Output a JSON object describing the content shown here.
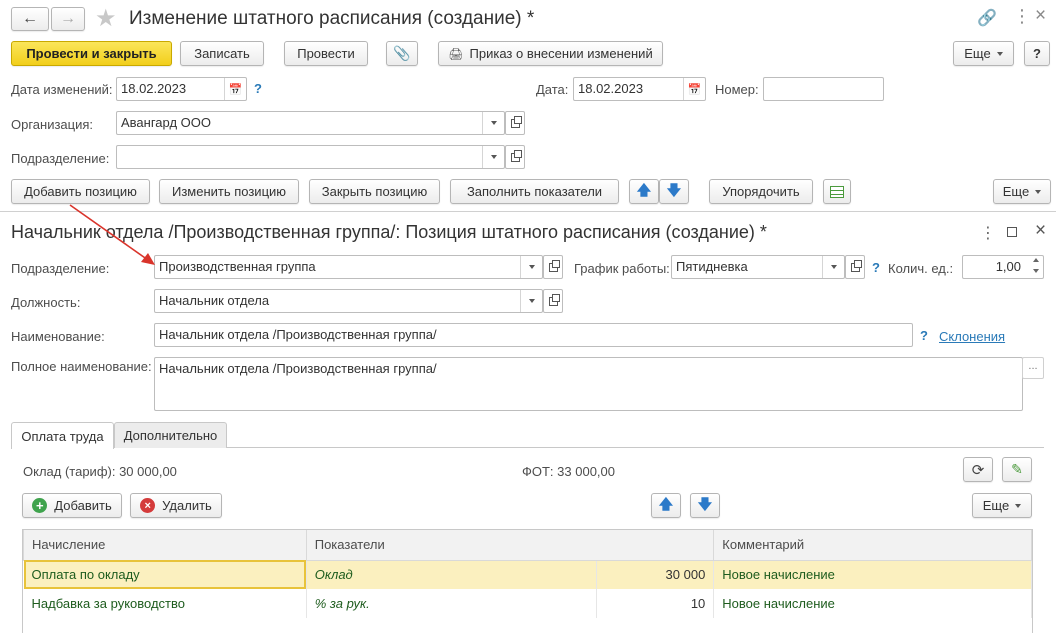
{
  "window": {
    "title": "Изменение штатного расписания (создание) *"
  },
  "toolbar": {
    "post_close": "Провести и закрыть",
    "save": "Записать",
    "post": "Провести",
    "order": "Приказ о внесении изменений",
    "more": "Еще",
    "help": "?"
  },
  "header_fields": {
    "change_date_label": "Дата изменений:",
    "change_date_value": "18.02.2023",
    "date_label": "Дата:",
    "date_value": "18.02.2023",
    "number_label": "Номер:",
    "number_value": "",
    "org_label": "Организация:",
    "org_value": "Авангард ООО",
    "dept_label": "Подразделение:",
    "dept_value": ""
  },
  "positions_toolbar": {
    "add": "Добавить позицию",
    "edit": "Изменить позицию",
    "close": "Закрыть позицию",
    "fill": "Заполнить показатели",
    "sort": "Упорядочить",
    "more": "Еще"
  },
  "subform": {
    "title": "Начальник отдела /Производственная группа/: Позиция штатного расписания (создание) *",
    "dept_label": "Подразделение:",
    "dept_value": "Производственная группа",
    "schedule_label": "График работы:",
    "schedule_value": "Пятидневка",
    "units_label": "Колич. ед.:",
    "units_value": "1,00",
    "position_label": "Должность:",
    "position_value": "Начальник отдела",
    "name_label": "Наименование:",
    "name_value": "Начальник отдела /Производственная группа/",
    "declension_link": "Склонения",
    "fullname_label": "Полное наименование:",
    "fullname_value": "Начальник отдела /Производственная группа/",
    "ellipsis": "..."
  },
  "tabs": [
    {
      "label": "Оплата труда",
      "active": true
    },
    {
      "label": "Дополнительно",
      "active": false
    }
  ],
  "pay": {
    "salary_text": "Оклад (тариф): 30 000,00",
    "fot_text": "ФОТ: 33 000,00",
    "add": "Добавить",
    "delete": "Удалить",
    "more": "Еще"
  },
  "table": {
    "columns": [
      "Начисление",
      "Показатели",
      "Комментарий"
    ],
    "rows": [
      {
        "accrual": "Оплата по окладу",
        "indicator": "Оклад",
        "value": "30 000",
        "comment": "Новое начисление"
      },
      {
        "accrual": "Надбавка за руководство",
        "indicator": "% за рук.",
        "value": "10",
        "comment": "Новое начисление"
      }
    ]
  },
  "colors": {
    "primary_button": "#f2cf1b",
    "selected_row": "#fbf0bf",
    "link": "#2a7ab8",
    "accrual_text": "#1e5c1e",
    "arrow": "#d9342b"
  }
}
